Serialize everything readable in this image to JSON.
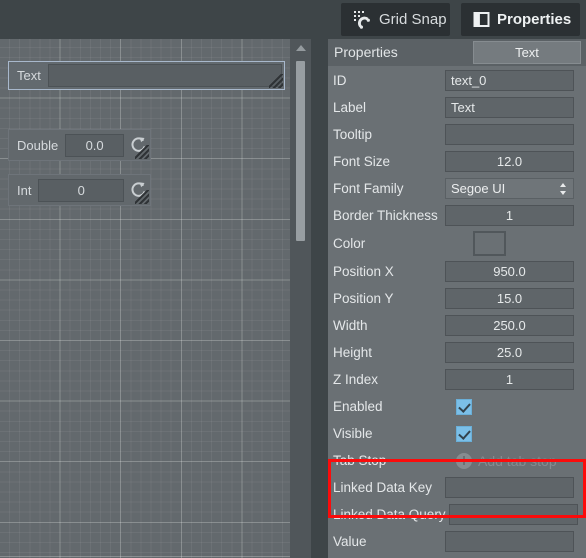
{
  "toolbar": {
    "grid_snap": {
      "label": "Grid Snap",
      "icon": "magnet-grid-snap-icon"
    },
    "properties": {
      "label": "Properties",
      "icon": "panel-properties-icon"
    }
  },
  "canvas": {
    "widgets": [
      {
        "name": "text-widget",
        "label": "Text",
        "value": "",
        "selected": true
      },
      {
        "name": "double-widget",
        "label": "Double",
        "value": "0.0",
        "selected": false
      },
      {
        "name": "int-widget",
        "label": "Int",
        "value": "0",
        "selected": false
      }
    ],
    "scrollbar": {
      "arrow_icon": "scroll-up-arrow-icon"
    }
  },
  "panel": {
    "title": "Properties",
    "tab_label": "Text",
    "properties": [
      {
        "label": "ID",
        "type": "text",
        "value": "text_0",
        "placeholder": "",
        "align": "left"
      },
      {
        "label": "Label",
        "type": "text",
        "value": "Text",
        "placeholder": "",
        "align": "left"
      },
      {
        "label": "Tooltip",
        "type": "text",
        "value": "",
        "placeholder": "",
        "align": "left"
      },
      {
        "label": "Font Size",
        "type": "text",
        "value": "12.0",
        "placeholder": "",
        "align": "center"
      },
      {
        "label": "Font Family",
        "type": "select",
        "value": "Segoe UI",
        "placeholder": "",
        "align": "left"
      },
      {
        "label": "Border Thickness",
        "type": "text",
        "value": "1",
        "placeholder": "",
        "align": "center"
      },
      {
        "label": "Color",
        "type": "color",
        "value": "#6a7074",
        "placeholder": "",
        "align": "left"
      },
      {
        "label": "Position X",
        "type": "text",
        "value": "950.0",
        "placeholder": "",
        "align": "center"
      },
      {
        "label": "Position Y",
        "type": "text",
        "value": "15.0",
        "placeholder": "",
        "align": "center"
      },
      {
        "label": "Width",
        "type": "text",
        "value": "250.0",
        "placeholder": "",
        "align": "center"
      },
      {
        "label": "Height",
        "type": "text",
        "value": "25.0",
        "placeholder": "",
        "align": "center"
      },
      {
        "label": "Z Index",
        "type": "text",
        "value": "1",
        "placeholder": "",
        "align": "center"
      },
      {
        "label": "Enabled",
        "type": "checkbox",
        "value": "checked",
        "placeholder": "",
        "align": "left"
      },
      {
        "label": "Visible",
        "type": "checkbox",
        "value": "checked",
        "placeholder": "",
        "align": "left"
      },
      {
        "label": "Tab Stop",
        "type": "action",
        "value": "Add tab stop",
        "placeholder": "",
        "align": "left"
      },
      {
        "label": "Linked Data Key",
        "type": "text",
        "value": "",
        "placeholder": "",
        "align": "left"
      },
      {
        "label": "Linked Data Query",
        "type": "text",
        "value": "",
        "placeholder": "",
        "align": "left"
      },
      {
        "label": "Value",
        "type": "text",
        "value": "",
        "placeholder": "",
        "align": "left"
      }
    ]
  },
  "annotation": {
    "highlight_color": "#fb0b0b",
    "highlight_name": "linked-data-highlight-box"
  }
}
